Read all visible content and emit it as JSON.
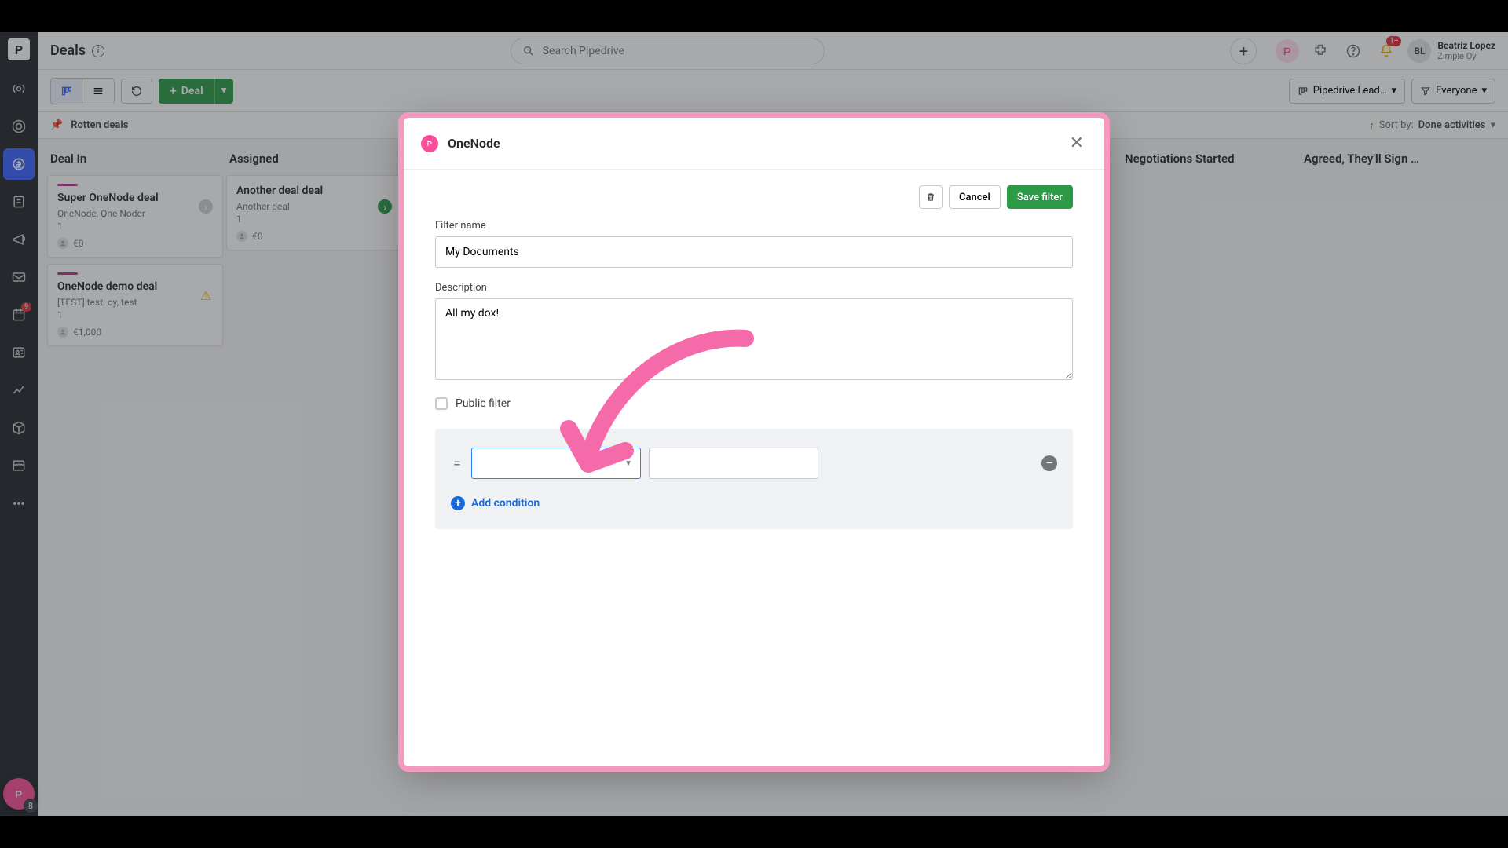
{
  "header": {
    "page_title": "Deals",
    "search_placeholder": "Search Pipedrive",
    "notification_badge": "1+",
    "user": {
      "initials": "BL",
      "name": "Beatriz Lopez",
      "company": "Zimple Oy"
    }
  },
  "sidebar": {
    "activity_badge": "9",
    "floating_badge": "8"
  },
  "toolbar": {
    "deal_button": "Deal",
    "filter1": "Pipedrive Lead…",
    "filter2": "Everyone"
  },
  "subbar": {
    "pinned": "Rotten deals",
    "sort_label": "Sort by:",
    "sort_value": "Done activities"
  },
  "columns": [
    {
      "title": "Deal In"
    },
    {
      "title": "Assigned"
    },
    {
      "title": ""
    },
    {
      "title": ""
    },
    {
      "title": ""
    },
    {
      "title": ""
    },
    {
      "title": "Negotiations Started"
    },
    {
      "title": "Agreed, They'll Sign …"
    }
  ],
  "cards": {
    "col0": [
      {
        "stripe": "#b23a8e",
        "title": "Super OneNode deal",
        "sub": "OneNode, One Noder",
        "num": "1",
        "value": "€0",
        "status_color": "#cfd1d4",
        "status_glyph": "›"
      },
      {
        "stripe": "#b23a8e",
        "title": "OneNode demo deal",
        "sub": "[TEST] testi oy, test",
        "num": "1",
        "value": "€1,000",
        "status_color": "#f7c948",
        "status_glyph": "!"
      }
    ],
    "col1": [
      {
        "title": "Another deal deal",
        "sub": "Another deal",
        "num": "1",
        "value": "€0",
        "status_color": "#2d9a47",
        "status_glyph": "›"
      }
    ]
  },
  "modal": {
    "title": "OneNode",
    "buttons": {
      "cancel": "Cancel",
      "save": "Save filter"
    },
    "filter_name_label": "Filter name",
    "filter_name_value": "My Documents",
    "description_label": "Description",
    "description_value": "All my dox!",
    "public_label": "Public filter",
    "operator": "=",
    "add_condition": "Add condition"
  }
}
